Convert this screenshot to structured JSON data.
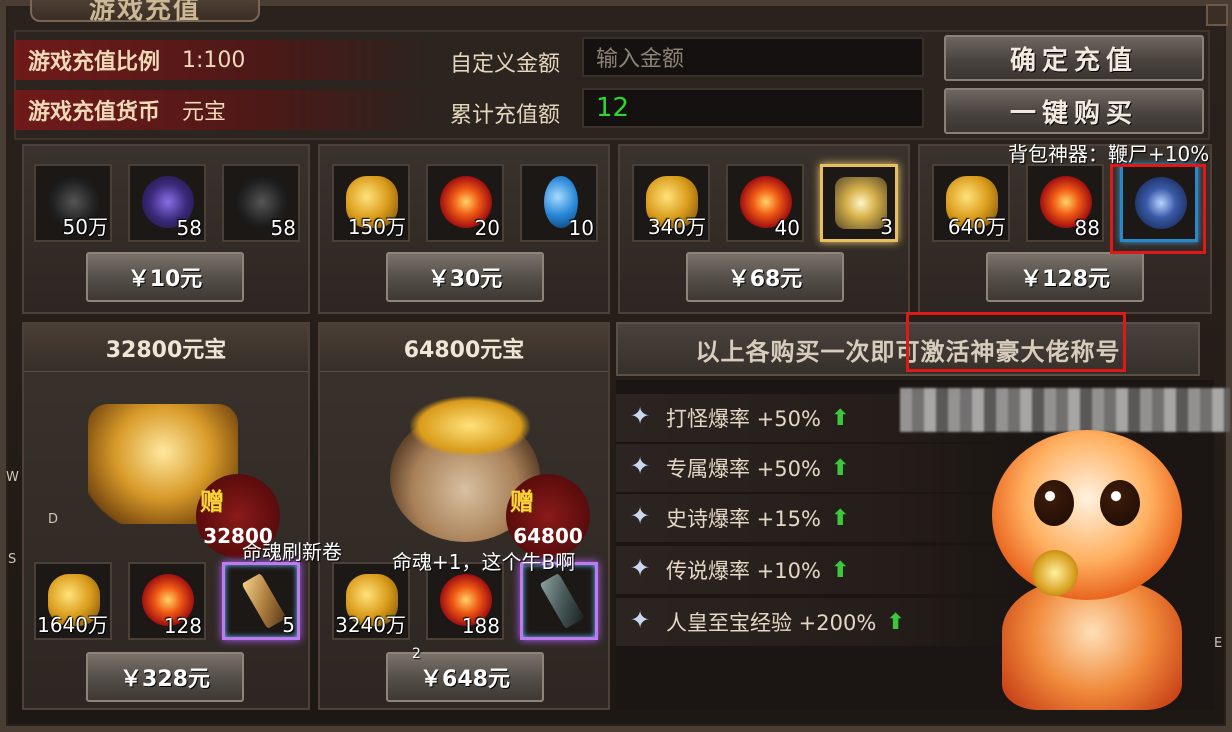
{
  "window": {
    "title": "游戏充值"
  },
  "info": {
    "ratio_label": "游戏充值比例",
    "ratio_value": "1:100",
    "currency_label": "游戏充值货币",
    "currency_value": "元宝",
    "custom_amount_label": "自定义金额",
    "custom_amount_placeholder": "输入金额",
    "total_label": "累计充值额",
    "total_value": "12",
    "confirm_button": "确定充值",
    "buy_all_button": "一键购买"
  },
  "packs": [
    {
      "items": [
        {
          "icon": "black-orb-icon",
          "qty": "50万"
        },
        {
          "icon": "purple-orb-icon",
          "qty": "58"
        },
        {
          "icon": "dark-orb-icon",
          "qty": "58"
        }
      ],
      "price": "￥10元"
    },
    {
      "items": [
        {
          "icon": "gold-ingot-icon",
          "qty": "150万"
        },
        {
          "icon": "fire-orb-icon",
          "qty": "20"
        },
        {
          "icon": "blue-potion-icon",
          "qty": "10"
        }
      ],
      "price": "￥30元"
    },
    {
      "items": [
        {
          "icon": "gold-ingot-icon",
          "qty": "340万"
        },
        {
          "icon": "fire-orb-icon",
          "qty": "40"
        },
        {
          "icon": "crystal-gem-icon",
          "qty": "3"
        }
      ],
      "price": "￥68元"
    },
    {
      "items": [
        {
          "icon": "gold-ingot-icon",
          "qty": "640万"
        },
        {
          "icon": "fire-orb-icon",
          "qty": "88"
        },
        {
          "icon": "artifact-whip-icon",
          "qty": ""
        }
      ],
      "price": "￥128元"
    }
  ],
  "big_packs": [
    {
      "title": "32800元宝",
      "bonus_tag": "赠",
      "bonus_value": "32800",
      "items": [
        {
          "icon": "gold-ingot-icon",
          "qty": "1640万"
        },
        {
          "icon": "fire-orb-icon",
          "qty": "128"
        },
        {
          "icon": "scroll-icon",
          "qty": "5"
        }
      ],
      "price": "￥328元"
    },
    {
      "title": "64800元宝",
      "bonus_tag": "赠",
      "bonus_value": "64800",
      "items": [
        {
          "icon": "gold-ingot-icon",
          "qty": "3240万"
        },
        {
          "icon": "fire-orb-icon",
          "qty": "188"
        },
        {
          "icon": "scroll-icon",
          "qty": ""
        }
      ],
      "price": "￥648元"
    }
  ],
  "annotations": {
    "artifact_note": "背包神器：鞭尸+10%",
    "scroll_note_1": "命魂刷新卷",
    "scroll_note_2": "命魂+1，这个牛B啊",
    "stray_mark": "2"
  },
  "activate_text": "以上各购买一次即可激活神豪大佬称号",
  "bonuses": [
    {
      "label": "打怪爆率 +50%"
    },
    {
      "label": "专属爆率 +50%"
    },
    {
      "label": "史诗爆率 +15%"
    },
    {
      "label": "传说爆率 +10%"
    },
    {
      "label": "人皇至宝经验 +200%"
    }
  ],
  "side_letters": {
    "w": "W",
    "d": "D",
    "s": "S",
    "e": "E"
  },
  "colors": {
    "accent_red": "#e01818",
    "total_green": "#2bd82b",
    "arrow_green": "#3cc83c"
  }
}
